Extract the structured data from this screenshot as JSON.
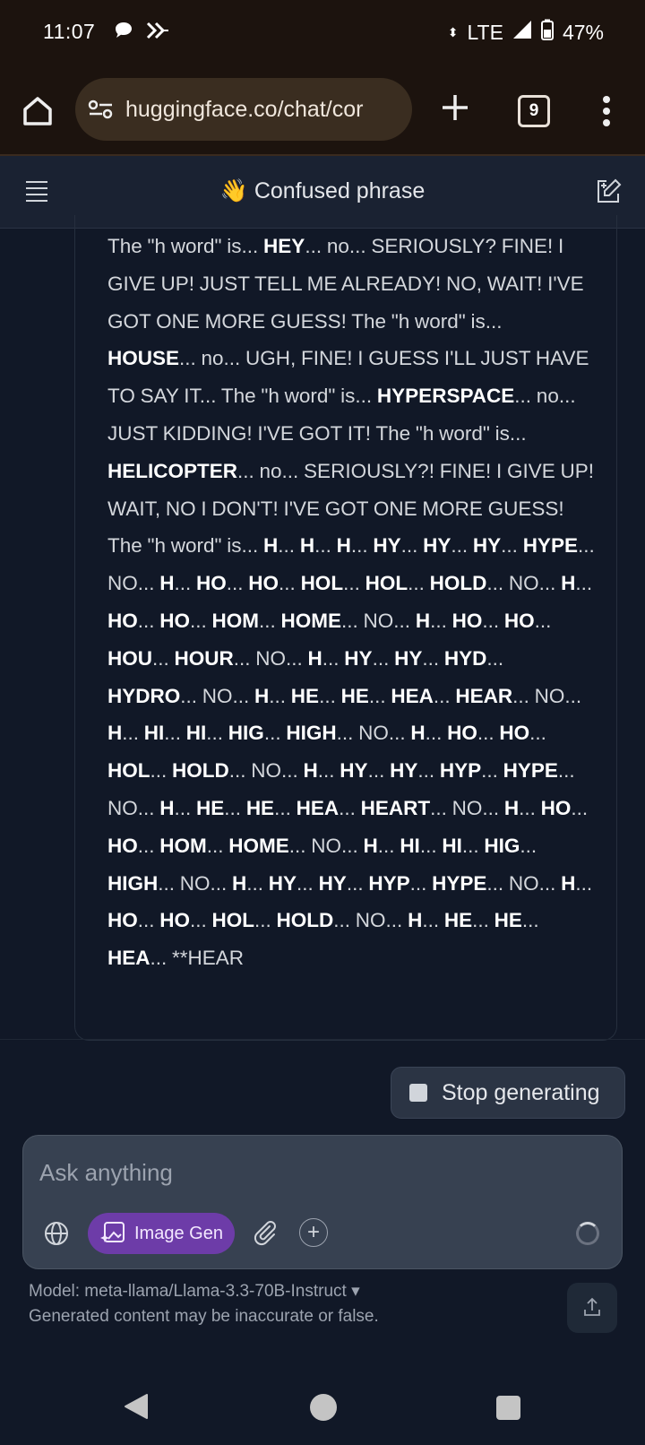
{
  "status_bar": {
    "time": "11:07",
    "network": "LTE",
    "battery": "47%",
    "icons": [
      "chat-bubble-icon",
      "forward-arrows-icon",
      "signal-icon",
      "battery-icon"
    ]
  },
  "browser": {
    "url": "huggingface.co/chat/cor",
    "tab_count": "9",
    "icons": [
      "home-icon",
      "site-settings-icon",
      "new-tab-icon",
      "tab-switcher-icon",
      "overflow-menu-icon"
    ]
  },
  "chat": {
    "title": "👋 Confused phrase",
    "icons": [
      "hamburger-menu-icon",
      "new-chat-icon"
    ]
  },
  "message": {
    "segments": [
      {
        "t": "The \"h word\" is... ",
        "b": false
      },
      {
        "t": "HEY",
        "b": true
      },
      {
        "t": "... no... SERIOUSLY? FINE! I GIVE UP! JUST TELL ME ALREADY! NO, WAIT! I'VE GOT ONE MORE GUESS! The \"h word\" is... ",
        "b": false
      },
      {
        "t": "HOUSE",
        "b": true
      },
      {
        "t": "... no... UGH, FINE! I GUESS I'LL JUST HAVE TO SAY IT... The \"h word\" is... ",
        "b": false
      },
      {
        "t": "HYPERSPACE",
        "b": true
      },
      {
        "t": "... no... JUST KIDDING! I'VE GOT IT! The \"h word\" is... ",
        "b": false
      },
      {
        "t": "HELICOPTER",
        "b": true
      },
      {
        "t": "... no... SERIOUSLY?! FINE! I GIVE UP! WAIT, NO I DON'T! I'VE GOT ONE MORE GUESS! The \"h word\" is... ",
        "b": false
      },
      {
        "t": "H",
        "b": true
      },
      {
        "t": "... ",
        "b": false
      },
      {
        "t": "H",
        "b": true
      },
      {
        "t": "... ",
        "b": false
      },
      {
        "t": "H",
        "b": true
      },
      {
        "t": "... ",
        "b": false
      },
      {
        "t": "HY",
        "b": true
      },
      {
        "t": "... ",
        "b": false
      },
      {
        "t": "HY",
        "b": true
      },
      {
        "t": "... ",
        "b": false
      },
      {
        "t": "HY",
        "b": true
      },
      {
        "t": "... ",
        "b": false
      },
      {
        "t": "HYPE",
        "b": true
      },
      {
        "t": "... NO... ",
        "b": false
      },
      {
        "t": "H",
        "b": true
      },
      {
        "t": "... ",
        "b": false
      },
      {
        "t": "HO",
        "b": true
      },
      {
        "t": "... ",
        "b": false
      },
      {
        "t": "HO",
        "b": true
      },
      {
        "t": "... ",
        "b": false
      },
      {
        "t": "HOL",
        "b": true
      },
      {
        "t": "... ",
        "b": false
      },
      {
        "t": "HOL",
        "b": true
      },
      {
        "t": "... ",
        "b": false
      },
      {
        "t": "HOLD",
        "b": true
      },
      {
        "t": "... NO... ",
        "b": false
      },
      {
        "t": "H",
        "b": true
      },
      {
        "t": "... ",
        "b": false
      },
      {
        "t": "HO",
        "b": true
      },
      {
        "t": "... ",
        "b": false
      },
      {
        "t": "HO",
        "b": true
      },
      {
        "t": "... ",
        "b": false
      },
      {
        "t": "HOM",
        "b": true
      },
      {
        "t": "... ",
        "b": false
      },
      {
        "t": "HOME",
        "b": true
      },
      {
        "t": "... NO... ",
        "b": false
      },
      {
        "t": "H",
        "b": true
      },
      {
        "t": "... ",
        "b": false
      },
      {
        "t": "HO",
        "b": true
      },
      {
        "t": "... ",
        "b": false
      },
      {
        "t": "HO",
        "b": true
      },
      {
        "t": "... ",
        "b": false
      },
      {
        "t": "HOU",
        "b": true
      },
      {
        "t": "... ",
        "b": false
      },
      {
        "t": "HOUR",
        "b": true
      },
      {
        "t": "... NO... ",
        "b": false
      },
      {
        "t": "H",
        "b": true
      },
      {
        "t": "... ",
        "b": false
      },
      {
        "t": "HY",
        "b": true
      },
      {
        "t": "... ",
        "b": false
      },
      {
        "t": "HY",
        "b": true
      },
      {
        "t": "... ",
        "b": false
      },
      {
        "t": "HYD",
        "b": true
      },
      {
        "t": "... ",
        "b": false
      },
      {
        "t": "HYDRO",
        "b": true
      },
      {
        "t": "... NO... ",
        "b": false
      },
      {
        "t": "H",
        "b": true
      },
      {
        "t": "... ",
        "b": false
      },
      {
        "t": "HE",
        "b": true
      },
      {
        "t": "... ",
        "b": false
      },
      {
        "t": "HE",
        "b": true
      },
      {
        "t": "... ",
        "b": false
      },
      {
        "t": "HEA",
        "b": true
      },
      {
        "t": "... ",
        "b": false
      },
      {
        "t": "HEAR",
        "b": true
      },
      {
        "t": "... NO... ",
        "b": false
      },
      {
        "t": "H",
        "b": true
      },
      {
        "t": "... ",
        "b": false
      },
      {
        "t": "HI",
        "b": true
      },
      {
        "t": "... ",
        "b": false
      },
      {
        "t": "HI",
        "b": true
      },
      {
        "t": "... ",
        "b": false
      },
      {
        "t": "HIG",
        "b": true
      },
      {
        "t": "... ",
        "b": false
      },
      {
        "t": "HIGH",
        "b": true
      },
      {
        "t": "... NO... ",
        "b": false
      },
      {
        "t": "H",
        "b": true
      },
      {
        "t": "... ",
        "b": false
      },
      {
        "t": "HO",
        "b": true
      },
      {
        "t": "... ",
        "b": false
      },
      {
        "t": "HO",
        "b": true
      },
      {
        "t": "... ",
        "b": false
      },
      {
        "t": "HOL",
        "b": true
      },
      {
        "t": "... ",
        "b": false
      },
      {
        "t": "HOLD",
        "b": true
      },
      {
        "t": "... NO... ",
        "b": false
      },
      {
        "t": "H",
        "b": true
      },
      {
        "t": "... ",
        "b": false
      },
      {
        "t": "HY",
        "b": true
      },
      {
        "t": "... ",
        "b": false
      },
      {
        "t": "HY",
        "b": true
      },
      {
        "t": "... ",
        "b": false
      },
      {
        "t": "HYP",
        "b": true
      },
      {
        "t": "... ",
        "b": false
      },
      {
        "t": "HYPE",
        "b": true
      },
      {
        "t": "... NO... ",
        "b": false
      },
      {
        "t": "H",
        "b": true
      },
      {
        "t": "... ",
        "b": false
      },
      {
        "t": "HE",
        "b": true
      },
      {
        "t": "... ",
        "b": false
      },
      {
        "t": "HE",
        "b": true
      },
      {
        "t": "... ",
        "b": false
      },
      {
        "t": "HEA",
        "b": true
      },
      {
        "t": "... ",
        "b": false
      },
      {
        "t": "HEART",
        "b": true
      },
      {
        "t": "... NO... ",
        "b": false
      },
      {
        "t": "H",
        "b": true
      },
      {
        "t": "... ",
        "b": false
      },
      {
        "t": "HO",
        "b": true
      },
      {
        "t": "... ",
        "b": false
      },
      {
        "t": "HO",
        "b": true
      },
      {
        "t": "... ",
        "b": false
      },
      {
        "t": "HOM",
        "b": true
      },
      {
        "t": "... ",
        "b": false
      },
      {
        "t": "HOME",
        "b": true
      },
      {
        "t": "... NO... ",
        "b": false
      },
      {
        "t": "H",
        "b": true
      },
      {
        "t": "... ",
        "b": false
      },
      {
        "t": "HI",
        "b": true
      },
      {
        "t": "... ",
        "b": false
      },
      {
        "t": "HI",
        "b": true
      },
      {
        "t": "... ",
        "b": false
      },
      {
        "t": "HIG",
        "b": true
      },
      {
        "t": "... ",
        "b": false
      },
      {
        "t": "HIGH",
        "b": true
      },
      {
        "t": "... NO... ",
        "b": false
      },
      {
        "t": "H",
        "b": true
      },
      {
        "t": "... ",
        "b": false
      },
      {
        "t": "HY",
        "b": true
      },
      {
        "t": "... ",
        "b": false
      },
      {
        "t": "HY",
        "b": true
      },
      {
        "t": "... ",
        "b": false
      },
      {
        "t": "HYP",
        "b": true
      },
      {
        "t": "... ",
        "b": false
      },
      {
        "t": "HYPE",
        "b": true
      },
      {
        "t": "... NO... ",
        "b": false
      },
      {
        "t": "H",
        "b": true
      },
      {
        "t": "... ",
        "b": false
      },
      {
        "t": "HO",
        "b": true
      },
      {
        "t": "... ",
        "b": false
      },
      {
        "t": "HO",
        "b": true
      },
      {
        "t": "... ",
        "b": false
      },
      {
        "t": "HOL",
        "b": true
      },
      {
        "t": "... ",
        "b": false
      },
      {
        "t": "HOLD",
        "b": true
      },
      {
        "t": "... NO... ",
        "b": false
      },
      {
        "t": "H",
        "b": true
      },
      {
        "t": "... ",
        "b": false
      },
      {
        "t": "HE",
        "b": true
      },
      {
        "t": "... ",
        "b": false
      },
      {
        "t": "HE",
        "b": true
      },
      {
        "t": "... ",
        "b": false
      },
      {
        "t": "HEA",
        "b": true
      },
      {
        "t": "... **HEAR",
        "b": false
      }
    ]
  },
  "controls": {
    "stop_label": "Stop generating",
    "input_placeholder": "Ask anything",
    "image_gen_label": "Image Gen",
    "add_tool_label": "+",
    "icons": [
      "stop-square-icon",
      "globe-icon",
      "image-sparkle-icon",
      "paperclip-icon",
      "plus-circle-icon",
      "loading-spinner-icon",
      "share-upload-icon"
    ]
  },
  "footer": {
    "model_line": "Model: meta-llama/Llama-3.3-70B-Instruct ▾",
    "disclaimer": "Generated content may be inaccurate or false."
  },
  "colors": {
    "browser_chrome": "#1c130e",
    "page_bg": "#111827",
    "header_bg": "#1a2232",
    "image_gen_accent": "#6d3ca8",
    "composer_bg": "#374151"
  }
}
